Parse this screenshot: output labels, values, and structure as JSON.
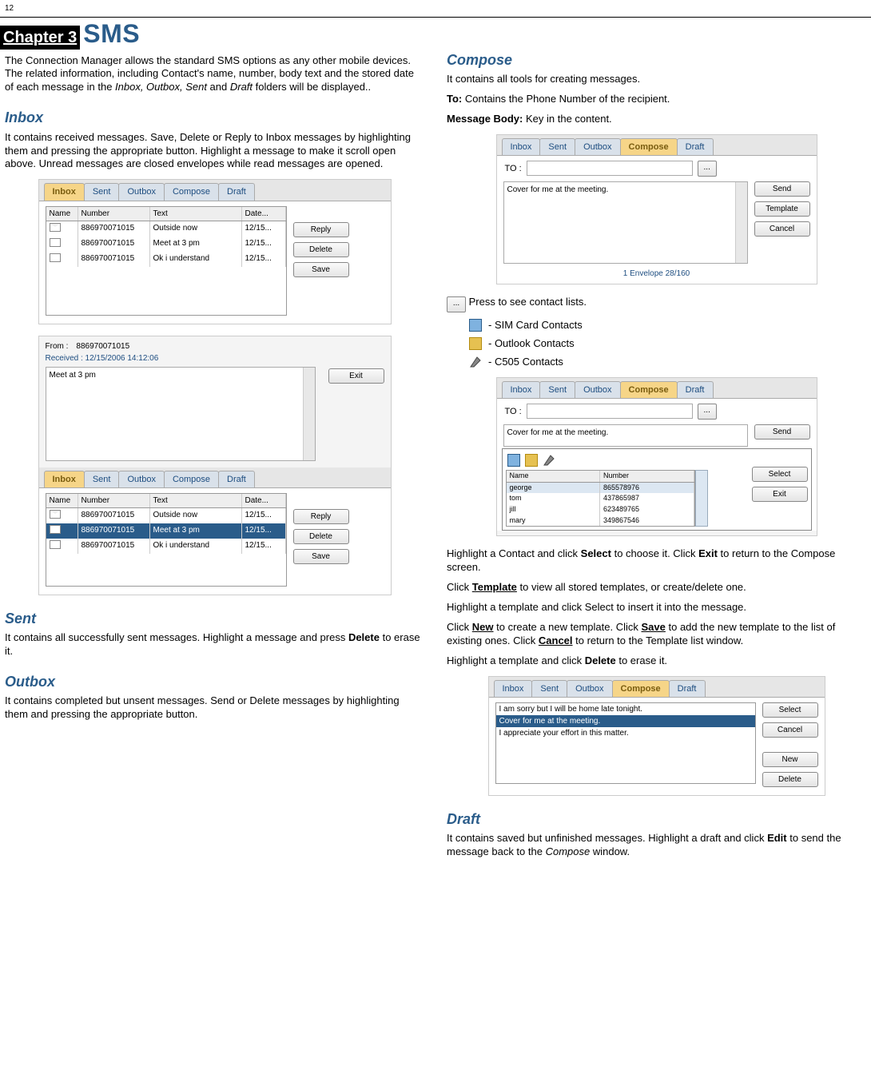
{
  "page_number": "12",
  "chapter_label": "Chapter 3",
  "chapter_title": "SMS",
  "left": {
    "intro": "The Connection Manager allows the standard SMS options as any other mobile devices. The related information, including Contact's name, number, body text and the stored date of each message in the ",
    "intro_folders": "Inbox, Outbox, Sent",
    "intro_and": " and ",
    "intro_draft": "Draft",
    "intro_tail": " folders will be displayed..",
    "inbox": {
      "title": "Inbox",
      "text": "It contains received messages. Save, Delete or Reply to Inbox messages by highlighting them and pressing the appropriate button. Highlight a message to make it scroll open above. Unread messages are closed envelopes while read messages are opened."
    },
    "sent": {
      "title": "Sent",
      "text_pre": "It contains all successfully sent messages. Highlight a message and press ",
      "text_bold": "Delete",
      "text_post": " to erase it."
    },
    "outbox": {
      "title": "Outbox",
      "text": "It contains completed but unsent messages. Send or Delete messages by highlighting them and pressing the appropriate button."
    },
    "shot1": {
      "tabs": [
        "Inbox",
        "Sent",
        "Outbox",
        "Compose",
        "Draft"
      ],
      "active": "Inbox",
      "headers": [
        "Name",
        "Number",
        "Text",
        "Date..."
      ],
      "rows": [
        {
          "icon": "closed",
          "num": "886970071015",
          "text": "Outside now",
          "date": "12/15..."
        },
        {
          "icon": "open",
          "num": "886970071015",
          "text": "Meet at 3 pm",
          "date": "12/15..."
        },
        {
          "icon": "open",
          "num": "886970071015",
          "text": "Ok i understand",
          "date": "12/15..."
        }
      ],
      "buttons": [
        "Reply",
        "Delete",
        "Save"
      ]
    },
    "shot2": {
      "from_label": "From :",
      "from_value": "886970071015",
      "received": "Received : 12/15/2006 14:12:06",
      "msg": "Meet at 3 pm",
      "exit": "Exit",
      "tabs": [
        "Inbox",
        "Sent",
        "Outbox",
        "Compose",
        "Draft"
      ],
      "active": "Inbox",
      "headers": [
        "Name",
        "Number",
        "Text",
        "Date..."
      ],
      "rows": [
        {
          "icon": "closed",
          "num": "886970071015",
          "text": "Outside now",
          "date": "12/15...",
          "sel": false
        },
        {
          "icon": "open",
          "num": "886970071015",
          "text": "Meet at 3 pm",
          "date": "12/15...",
          "sel": true
        },
        {
          "icon": "open",
          "num": "886970071015",
          "text": "Ok i understand",
          "date": "12/15...",
          "sel": false
        }
      ],
      "buttons": [
        "Reply",
        "Delete",
        "Save"
      ]
    }
  },
  "right": {
    "compose": {
      "title": "Compose",
      "line1": "It contains all tools for creating messages.",
      "to_label_bold": "To:",
      "to_text": " Contains the Phone Number of the recipient.",
      "body_label_bold": "Message Body:",
      "body_text": " Key in the content."
    },
    "shot3": {
      "tabs": [
        "Inbox",
        "Sent",
        "Outbox",
        "Compose",
        "Draft"
      ],
      "active": "Compose",
      "to_label": "TO :",
      "dots": "...",
      "msg": "Cover for me at the meeting.",
      "buttons": [
        "Send",
        "Template",
        "Cancel"
      ],
      "counter": "1 Envelope  28/160"
    },
    "dots_inline": "...",
    "press_text": " Press to see contact lists.",
    "contacts": {
      "sim": "- SIM Card Contacts",
      "outlook": "- Outlook Contacts",
      "c505": "- C505 Contacts"
    },
    "shot4": {
      "tabs": [
        "Inbox",
        "Sent",
        "Outbox",
        "Compose",
        "Draft"
      ],
      "active": "Compose",
      "to_label": "TO :",
      "dots": "...",
      "msg": "Cover for me at the meeting.",
      "send": "Send",
      "headers": [
        "Name",
        "Number"
      ],
      "rows": [
        {
          "name": "george",
          "num": "865578976"
        },
        {
          "name": "tom",
          "num": "437865987"
        },
        {
          "name": "jill",
          "num": "623489765"
        },
        {
          "name": "mary",
          "num": "349867546"
        }
      ],
      "buttons": [
        "Select",
        "Exit"
      ]
    },
    "p1_pre": "Highlight a Contact and click ",
    "p1_b1": "Select",
    "p1_mid": " to choose it. Click ",
    "p1_b2": "Exit",
    "p1_post": " to return to the Compose screen.",
    "p2_pre": "Click ",
    "p2_b": "Template",
    "p2_post": " to view all stored templates, or create/delete one.",
    "p3": "Highlight a template and click Select to insert it into the message.",
    "p4_pre": "Click ",
    "p4_b1": "New",
    "p4_mid1": " to create a new template. Click ",
    "p4_b2": "Save",
    "p4_mid2": " to add the new template to the list of existing ones. Click ",
    "p4_b3": "Cancel",
    "p4_post": " to return to the Template list window.",
    "p5_pre": "Highlight a template and click ",
    "p5_b": "Delete",
    "p5_post": " to erase it.",
    "shot5": {
      "tabs": [
        "Inbox",
        "Sent",
        "Outbox",
        "Compose",
        "Draft"
      ],
      "active": "Compose",
      "rows": [
        {
          "text": "I am sorry but I will be home late tonight.",
          "sel": false
        },
        {
          "text": "Cover for me at the meeting.",
          "sel": true
        },
        {
          "text": "I appreciate your effort in this matter.",
          "sel": false
        }
      ],
      "buttons": [
        "Select",
        "Cancel",
        "New",
        "Delete"
      ]
    },
    "draft": {
      "title": "Draft",
      "text_pre": "It contains saved but unfinished messages. Highlight a draft and click ",
      "text_b": "Edit",
      "text_mid": " to send the message back to the ",
      "text_i": "Compose",
      "text_post": " window."
    }
  }
}
